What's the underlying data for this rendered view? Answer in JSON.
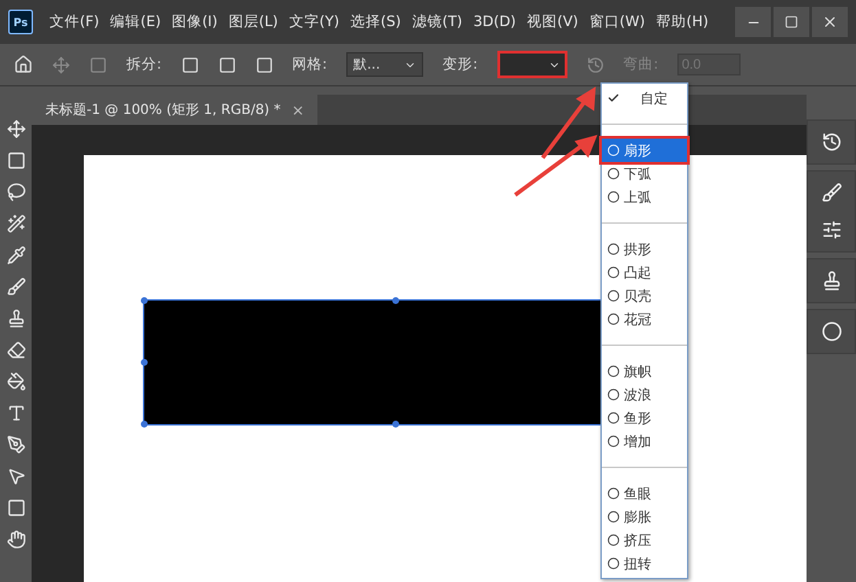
{
  "app_icon": "Ps",
  "menus": [
    {
      "label": "文件(F)"
    },
    {
      "label": "编辑(E)"
    },
    {
      "label": "图像(I)"
    },
    {
      "label": "图层(L)"
    },
    {
      "label": "文字(Y)"
    },
    {
      "label": "选择(S)"
    },
    {
      "label": "滤镜(T)"
    },
    {
      "label": "3D(D)"
    },
    {
      "label": "视图(V)"
    },
    {
      "label": "窗口(W)"
    },
    {
      "label": "帮助(H)"
    }
  ],
  "options_bar": {
    "split_label": "拆分:",
    "grid_label": "网格:",
    "grid_value": "默...",
    "warp_label": "变形:",
    "bend_label": "弯曲:",
    "bend_value": "0.0",
    "bend_disabled": true
  },
  "document_tab": {
    "title": "未标题-1 @ 100% (矩形 1, RGB/8) *",
    "close": "×"
  },
  "warp_menu": [
    {
      "kind": "item",
      "label": "自定",
      "checked": true,
      "selected": false
    },
    {
      "kind": "separator"
    },
    {
      "kind": "item",
      "label": "扇形",
      "checked": false,
      "selected": true
    },
    {
      "kind": "item",
      "label": "下弧",
      "checked": false,
      "selected": false
    },
    {
      "kind": "item",
      "label": "上弧",
      "checked": false,
      "selected": false
    },
    {
      "kind": "separator"
    },
    {
      "kind": "item",
      "label": "拱形",
      "checked": false,
      "selected": false
    },
    {
      "kind": "item",
      "label": "凸起",
      "checked": false,
      "selected": false
    },
    {
      "kind": "item",
      "label": "贝壳",
      "checked": false,
      "selected": false
    },
    {
      "kind": "item",
      "label": "花冠",
      "checked": false,
      "selected": false
    },
    {
      "kind": "separator"
    },
    {
      "kind": "item",
      "label": "旗帜",
      "checked": false,
      "selected": false
    },
    {
      "kind": "item",
      "label": "波浪",
      "checked": false,
      "selected": false
    },
    {
      "kind": "item",
      "label": "鱼形",
      "checked": false,
      "selected": false
    },
    {
      "kind": "item",
      "label": "增加",
      "checked": false,
      "selected": false
    },
    {
      "kind": "separator"
    },
    {
      "kind": "item",
      "label": "鱼眼",
      "checked": false,
      "selected": false
    },
    {
      "kind": "item",
      "label": "膨胀",
      "checked": false,
      "selected": false
    },
    {
      "kind": "item",
      "label": "挤压",
      "checked": false,
      "selected": false
    },
    {
      "kind": "item",
      "label": "扭转",
      "checked": false,
      "selected": false
    }
  ]
}
